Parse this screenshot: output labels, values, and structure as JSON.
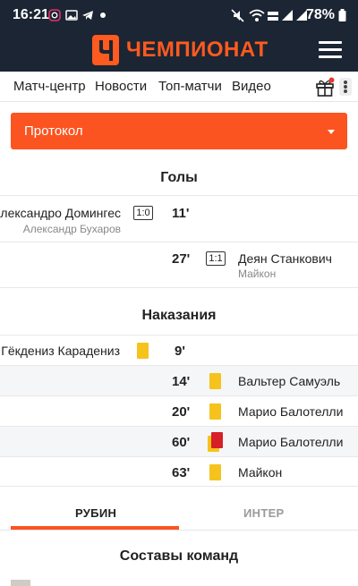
{
  "status_bar": {
    "time": "16:21",
    "battery": "78%",
    "icons": [
      "instagram-icon",
      "image-icon",
      "telegram-icon",
      "dot-icon",
      "mute-icon",
      "wifi-icon",
      "volte-icon",
      "signal-icon",
      "signal-icon",
      "battery-icon"
    ]
  },
  "app": {
    "logo_text": "ЧЕМПИОНАТ",
    "brand_color": "#fb5420",
    "header_color": "#1b2533"
  },
  "nav": {
    "items": [
      "Матч-центр",
      "Новости",
      "Топ-матчи",
      "Видео"
    ]
  },
  "protocol": {
    "label": "Протокол"
  },
  "goals": {
    "title": "Голы",
    "events": [
      {
        "side": "home",
        "minute": "11'",
        "score": "1:0",
        "player": "Александро Домингес",
        "assist": "Александр Бухаров"
      },
      {
        "side": "away",
        "minute": "27'",
        "score": "1:1",
        "player": "Деян Станкович",
        "assist": "Майкон"
      }
    ]
  },
  "penalties": {
    "title": "Наказания",
    "events": [
      {
        "side": "home",
        "minute": "9'",
        "player": "Гёкдениз Карадениз",
        "card": "yellow"
      },
      {
        "side": "away",
        "minute": "14'",
        "player": "Вальтер Самуэль",
        "card": "yellow"
      },
      {
        "side": "away",
        "minute": "20'",
        "player": "Марио Балотелли",
        "card": "yellow"
      },
      {
        "side": "away",
        "minute": "60'",
        "player": "Марио Балотелли",
        "card": "second-yellow-red"
      },
      {
        "side": "away",
        "minute": "63'",
        "player": "Майкон",
        "card": "yellow"
      }
    ]
  },
  "tabs": {
    "home": "РУБИН",
    "away": "ИНТЕР",
    "active": "home"
  },
  "lineups": {
    "title": "Составы команд"
  }
}
